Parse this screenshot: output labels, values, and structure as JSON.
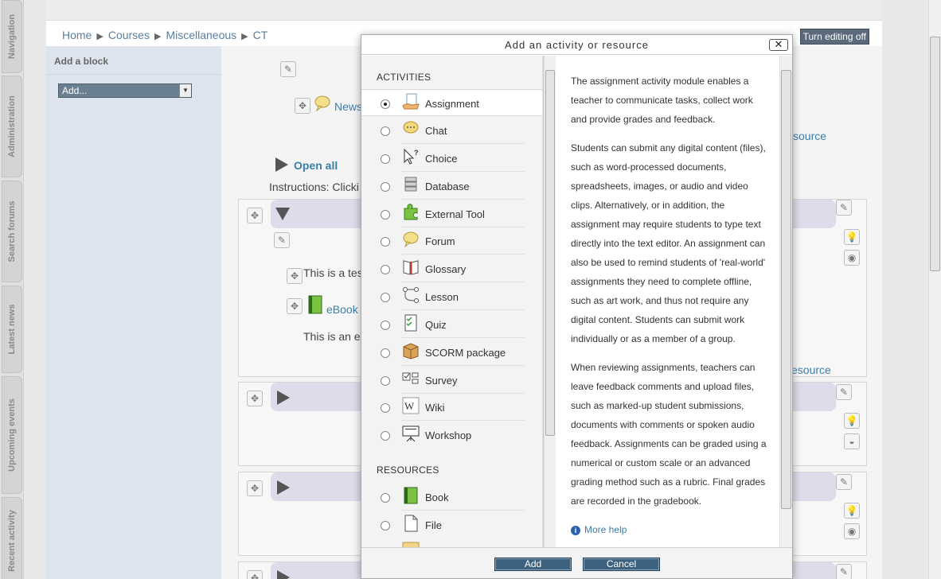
{
  "dock": {
    "tabs": [
      {
        "label": "Navigation"
      },
      {
        "label": "Administration"
      },
      {
        "label": "Search forums"
      },
      {
        "label": "Latest news"
      },
      {
        "label": "Upcoming events"
      },
      {
        "label": "Recent activity"
      }
    ]
  },
  "breadcrumb": {
    "items": [
      "Home",
      "Courses",
      "Miscellaneous",
      "CT"
    ],
    "separator": "▶"
  },
  "header": {
    "turn_editing_off": "Turn editing off"
  },
  "block": {
    "title": "Add a block",
    "select_value": "Add..."
  },
  "course": {
    "news_link": "News",
    "open_all": "Open all",
    "instructions": "Instructions: Clicki",
    "topic_text": "This is a tes",
    "ebook_link": "eBook",
    "ebook_desc": "This is an e",
    "resource_link_1": "source",
    "resource_link_2": "esource"
  },
  "dialog": {
    "title": "Add an activity or resource",
    "close": "✕",
    "activities_heading": "ACTIVITIES",
    "resources_heading": "RESOURCES",
    "activities": [
      {
        "label": "Assignment",
        "icon": "assignment-icon",
        "selected": true
      },
      {
        "label": "Chat",
        "icon": "chat-icon",
        "selected": false
      },
      {
        "label": "Choice",
        "icon": "choice-icon",
        "selected": false
      },
      {
        "label": "Database",
        "icon": "database-icon",
        "selected": false
      },
      {
        "label": "External Tool",
        "icon": "external-tool-icon",
        "selected": false
      },
      {
        "label": "Forum",
        "icon": "forum-icon",
        "selected": false
      },
      {
        "label": "Glossary",
        "icon": "glossary-icon",
        "selected": false
      },
      {
        "label": "Lesson",
        "icon": "lesson-icon",
        "selected": false
      },
      {
        "label": "Quiz",
        "icon": "quiz-icon",
        "selected": false
      },
      {
        "label": "SCORM package",
        "icon": "scorm-icon",
        "selected": false
      },
      {
        "label": "Survey",
        "icon": "survey-icon",
        "selected": false
      },
      {
        "label": "Wiki",
        "icon": "wiki-icon",
        "selected": false
      },
      {
        "label": "Workshop",
        "icon": "workshop-icon",
        "selected": false
      }
    ],
    "resources": [
      {
        "label": "Book",
        "icon": "book-icon",
        "selected": false
      },
      {
        "label": "File",
        "icon": "file-icon",
        "selected": false
      }
    ],
    "help": {
      "p1": "The assignment activity module enables a teacher to communicate tasks, collect work and provide grades and feedback.",
      "p2": "Students can submit any digital content (files), such as word-processed documents, spreadsheets, images, or audio and video clips. Alternatively, or in addition, the assignment may require students to type text directly into the text editor. An assignment can also be used to remind students of 'real-world' assignments they need to complete offline, such as art work, and thus not require any digital content. Students can submit work individually or as a member of a group.",
      "p3": "When reviewing assignments, teachers can leave feedback comments and upload files, such as marked-up student submissions, documents with comments or spoken audio feedback. Assignments can be graded using a numerical or custom scale or an advanced grading method such as a rubric. Final grades are recorded in the gradebook.",
      "more_help": "More help"
    },
    "add_button": "Add",
    "cancel_button": "Cancel"
  }
}
